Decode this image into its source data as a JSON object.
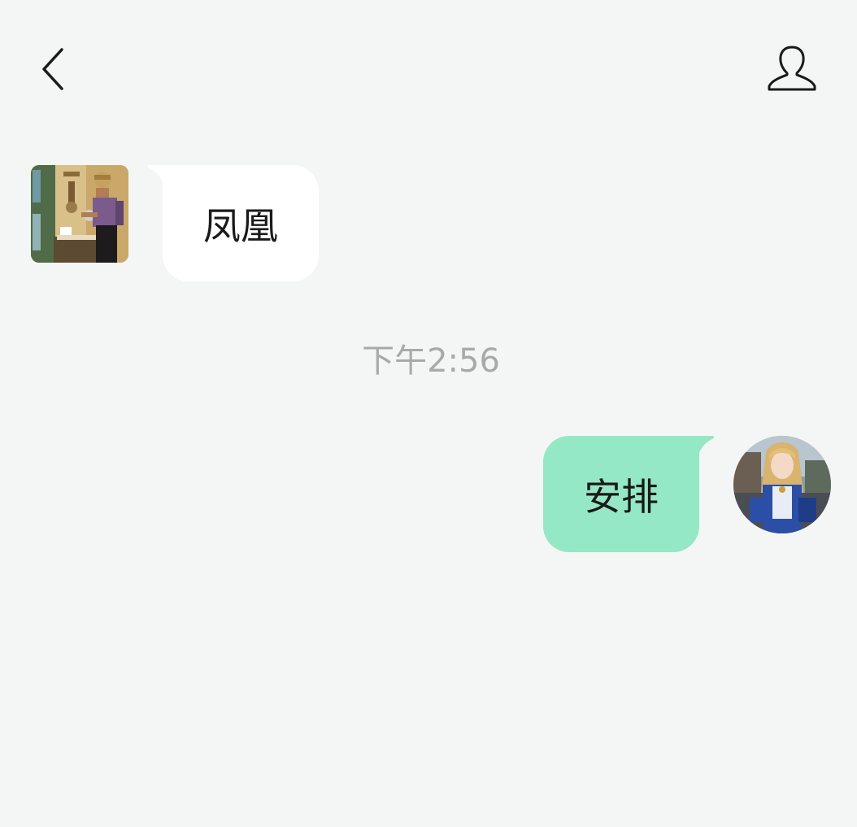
{
  "header": {
    "back_icon": "chevron-left-icon",
    "profile_icon": "person-outline-icon"
  },
  "messages": [
    {
      "direction": "incoming",
      "avatar": "illustration-man-at-counter",
      "text": "凤凰"
    },
    {
      "direction": "outgoing",
      "avatar": "photo-cosplay-girl",
      "text": "安排"
    }
  ],
  "timestamp": "下午2:56",
  "colors": {
    "background": "#f4f6f5",
    "incoming_bubble": "#ffffff",
    "outgoing_bubble": "#95e8c5",
    "timestamp_text": "#a8aaa9"
  }
}
